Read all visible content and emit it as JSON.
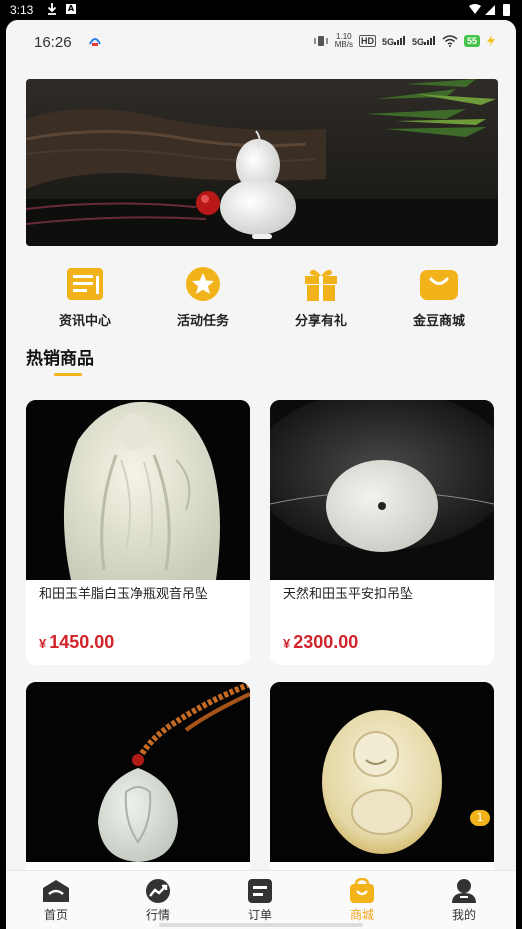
{
  "android_status": {
    "time": "3:13"
  },
  "phone_status": {
    "time": "16:26",
    "net_speed_value": "1.10",
    "net_speed_unit": "MB/s",
    "hd": "HD",
    "sig1": "5G",
    "sig2": "5G",
    "battery": "55"
  },
  "quick_links": [
    {
      "label": "资讯中心",
      "icon": "news-icon"
    },
    {
      "label": "活动任务",
      "icon": "star-icon"
    },
    {
      "label": "分享有礼",
      "icon": "gift-icon"
    },
    {
      "label": "金豆商城",
      "icon": "shopping-bag-icon"
    }
  ],
  "section": {
    "title": "热销商品"
  },
  "products": [
    {
      "name": "和田玉羊脂白玉净瓶观音吊坠",
      "currency": "¥",
      "price": "1450.00"
    },
    {
      "name": "天然和田玉平安扣吊坠",
      "currency": "¥",
      "price": "2300.00"
    },
    {
      "name": "",
      "currency": "",
      "price": ""
    },
    {
      "name": "",
      "currency": "",
      "price": ""
    }
  ],
  "float_badge": "1",
  "tabs": [
    {
      "label": "首页",
      "icon": "home-icon"
    },
    {
      "label": "行情",
      "icon": "trend-icon"
    },
    {
      "label": "订单",
      "icon": "order-icon"
    },
    {
      "label": "商城",
      "icon": "shop-icon",
      "active": true
    },
    {
      "label": "我的",
      "icon": "user-icon"
    }
  ],
  "colors": {
    "accent": "#f2b31a",
    "price": "#d2232a",
    "active_tab": "#f2a41a"
  }
}
